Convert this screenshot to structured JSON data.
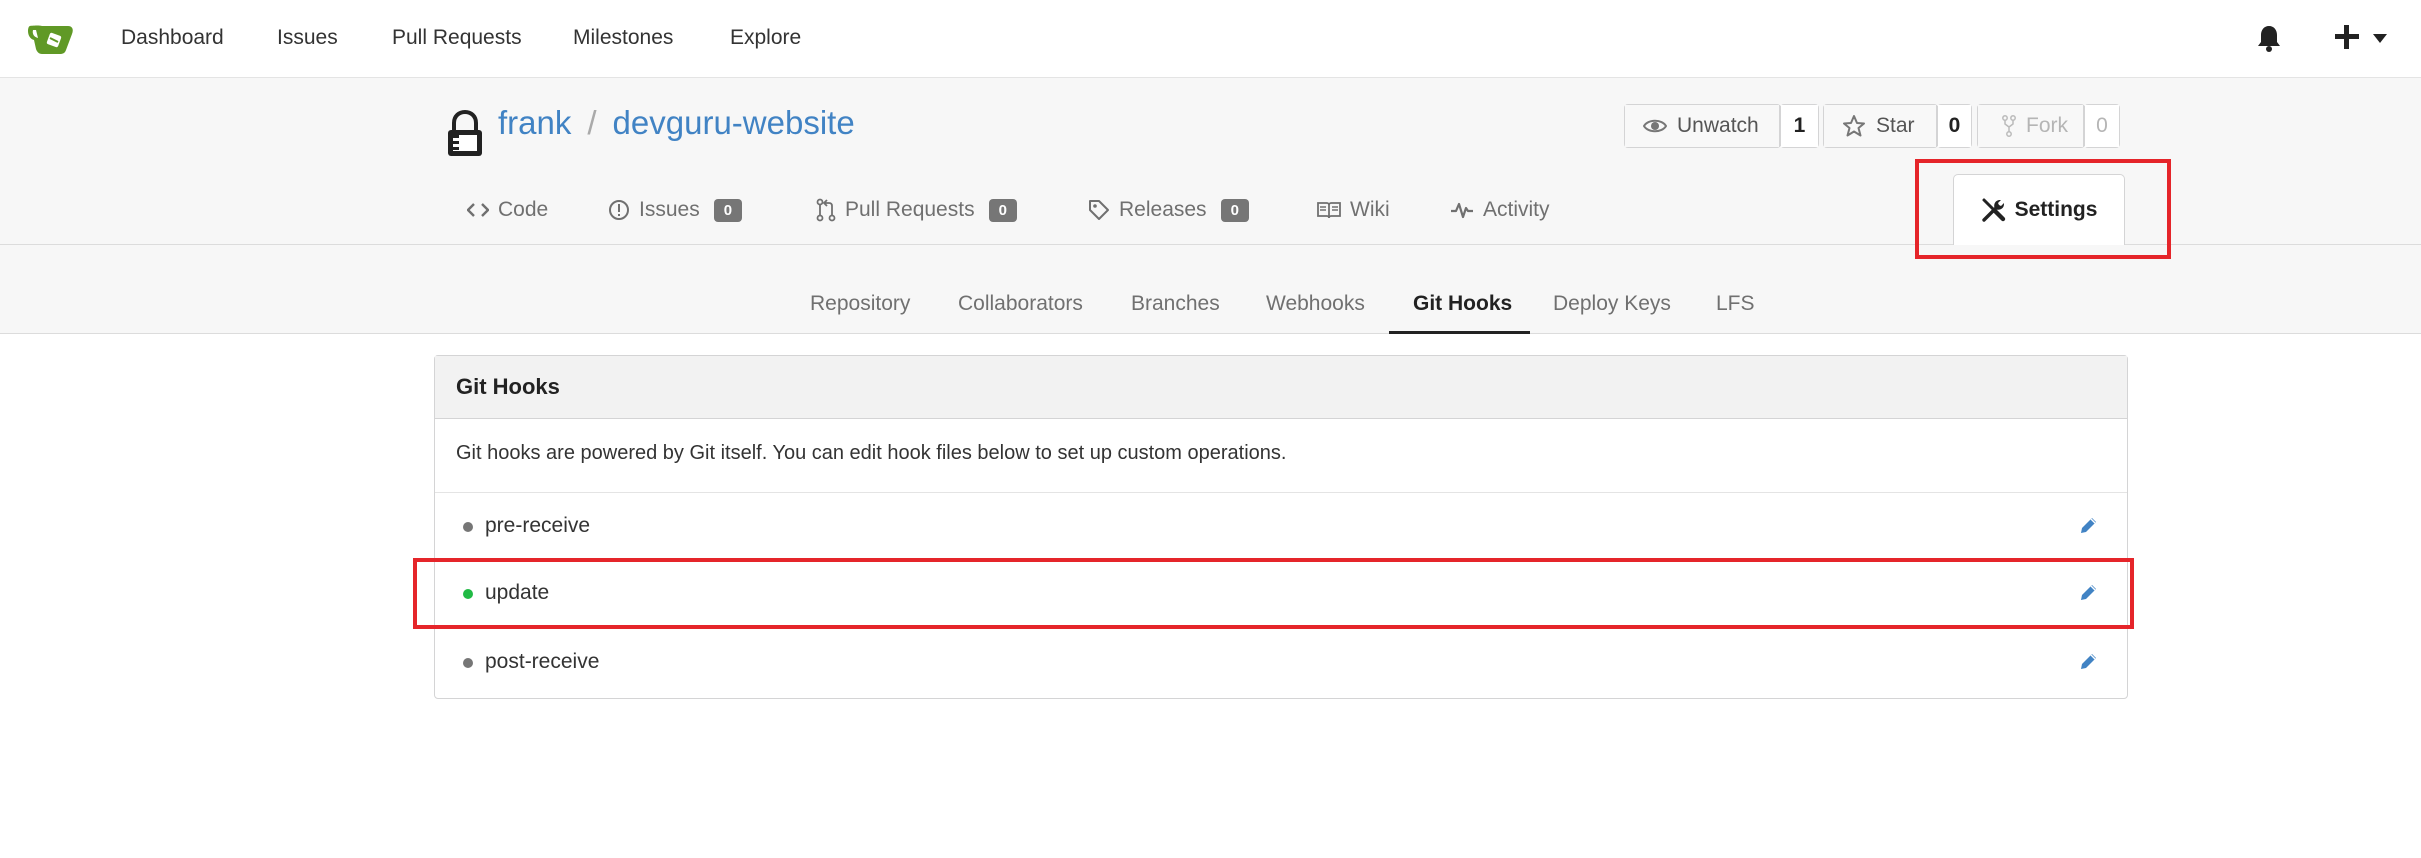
{
  "topnav": {
    "items": [
      "Dashboard",
      "Issues",
      "Pull Requests",
      "Milestones",
      "Explore"
    ]
  },
  "repo": {
    "owner": "frank",
    "separator": "/",
    "name": "devguru-website",
    "watch": {
      "label": "Unwatch",
      "count": "1"
    },
    "star": {
      "label": "Star",
      "count": "0"
    },
    "fork": {
      "label": "Fork",
      "count": "0"
    }
  },
  "repo_tabs": [
    {
      "label": "Code",
      "icon": "code-icon"
    },
    {
      "label": "Issues",
      "icon": "issue-icon",
      "badge": "0"
    },
    {
      "label": "Pull Requests",
      "icon": "pull-request-icon",
      "badge": "0"
    },
    {
      "label": "Releases",
      "icon": "tag-icon",
      "badge": "0"
    },
    {
      "label": "Wiki",
      "icon": "book-icon"
    },
    {
      "label": "Activity",
      "icon": "pulse-icon"
    }
  ],
  "settings_tab": {
    "label": "Settings",
    "icon": "tools-icon"
  },
  "settings_menu": [
    "Repository",
    "Collaborators",
    "Branches",
    "Webhooks",
    "Git Hooks",
    "Deploy Keys",
    "LFS"
  ],
  "settings_menu_active": "Git Hooks",
  "panel": {
    "title": "Git Hooks",
    "description": "Git hooks are powered by Git itself. You can edit hook files below to set up custom operations."
  },
  "hooks": [
    {
      "name": "pre-receive",
      "status_color": "#767676"
    },
    {
      "name": "update",
      "status_color": "#21ba45"
    },
    {
      "name": "post-receive",
      "status_color": "#767676"
    }
  ],
  "colors": {
    "link": "#4183c4",
    "highlight": "#e5252a",
    "logo": "#609926"
  }
}
